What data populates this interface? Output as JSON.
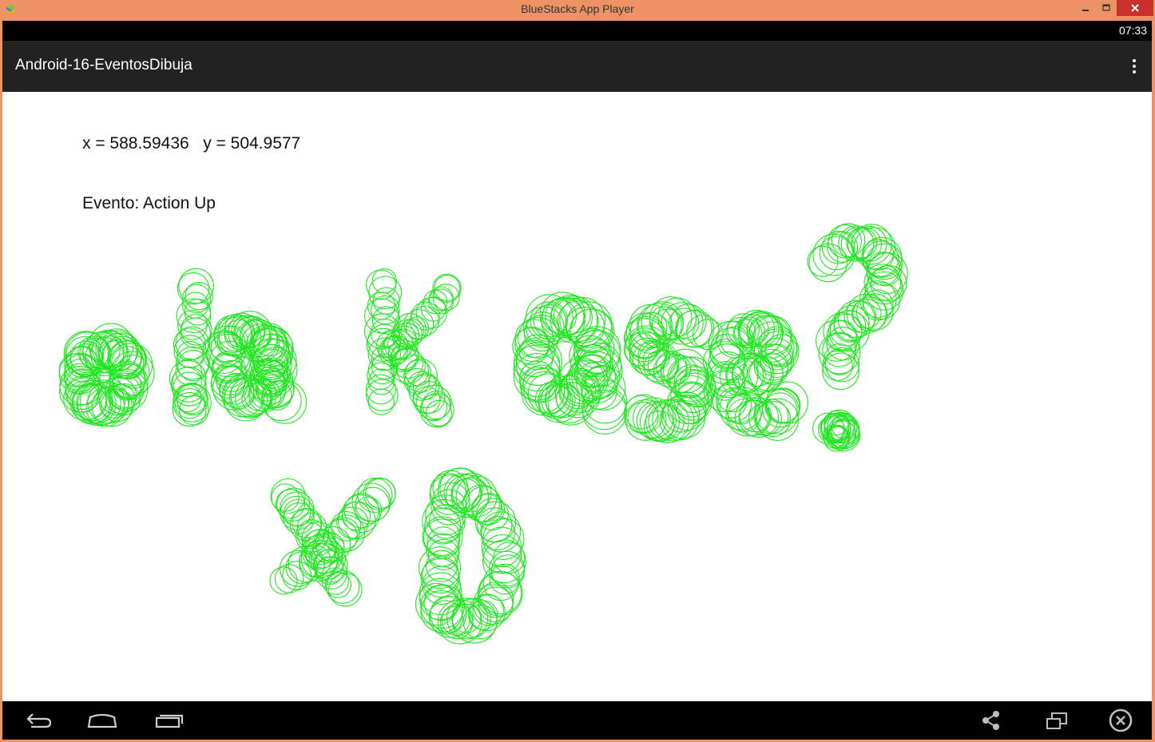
{
  "window": {
    "title": "BlueStacks App Player",
    "app_icon": "bluestacks-logo-icon",
    "buttons": {
      "minimize": "minimize-icon",
      "maximize": "maximize-icon",
      "close": "close-icon"
    }
  },
  "statusbar": {
    "clock": "07:33"
  },
  "actionbar": {
    "title": "Android-16-EventosDibuja",
    "overflow_icon": "more-vert-icon"
  },
  "content": {
    "coords_text": "x = 588.59436   y = 504.9577",
    "event_text": "Evento: Action Up",
    "stroke_color": "#22e622"
  },
  "navbar": {
    "icons": [
      "back-icon",
      "home-icon",
      "recents-icon",
      "share-icon",
      "rotate-icon",
      "exit-icon"
    ]
  },
  "colors": {
    "window_frame": "#ec9265",
    "actionbar": "#222222",
    "bars": "#000000",
    "close_button": "#c7302b"
  }
}
